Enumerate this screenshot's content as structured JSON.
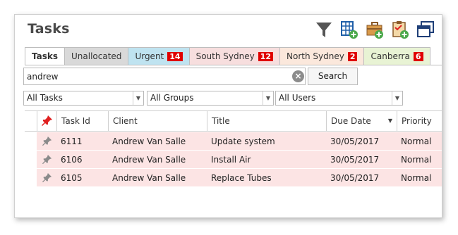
{
  "header": {
    "title": "Tasks"
  },
  "toolbar_icons": [
    "filter-icon",
    "add-table-icon",
    "add-briefcase-icon",
    "add-checklist-icon",
    "window-icon"
  ],
  "tabs": [
    {
      "label": "Tasks",
      "badge": "",
      "bg": "#ffffff"
    },
    {
      "label": "Unallocated",
      "badge": "",
      "bg": "#d9d9d9"
    },
    {
      "label": "Urgent",
      "badge": "14",
      "bg": "#bfe3f0"
    },
    {
      "label": "South Sydney",
      "badge": "12",
      "bg": "#f7dede"
    },
    {
      "label": "North Sydney",
      "badge": "2",
      "bg": "#fbe8dc"
    },
    {
      "label": "Canberra",
      "badge": "6",
      "bg": "#e8f3d4"
    }
  ],
  "search": {
    "value": "andrew",
    "button": "Search"
  },
  "filters": {
    "tasks": "All Tasks",
    "groups": "All Groups",
    "users": "All Users"
  },
  "columns": {
    "task_id": "Task Id",
    "client": "Client",
    "title": "Title",
    "due_date": "Due Date",
    "priority": "Priority"
  },
  "rows": [
    {
      "task_id": "6111",
      "client": "Andrew Van Salle",
      "title": "Update system",
      "due_date": "30/05/2017",
      "priority": "Normal"
    },
    {
      "task_id": "6106",
      "client": "Andrew Van Salle",
      "title": "Install Air",
      "due_date": "30/05/2017",
      "priority": "Normal"
    },
    {
      "task_id": "6105",
      "client": "Andrew Van Salle",
      "title": "Replace Tubes",
      "due_date": "30/05/2017",
      "priority": "Normal"
    }
  ],
  "colors": {
    "row_highlight": "#fce4e4",
    "badge": "#e00000",
    "pin_active": "#e02020",
    "icon_blue": "#1f5fa8",
    "icon_green": "#4aa84a"
  }
}
